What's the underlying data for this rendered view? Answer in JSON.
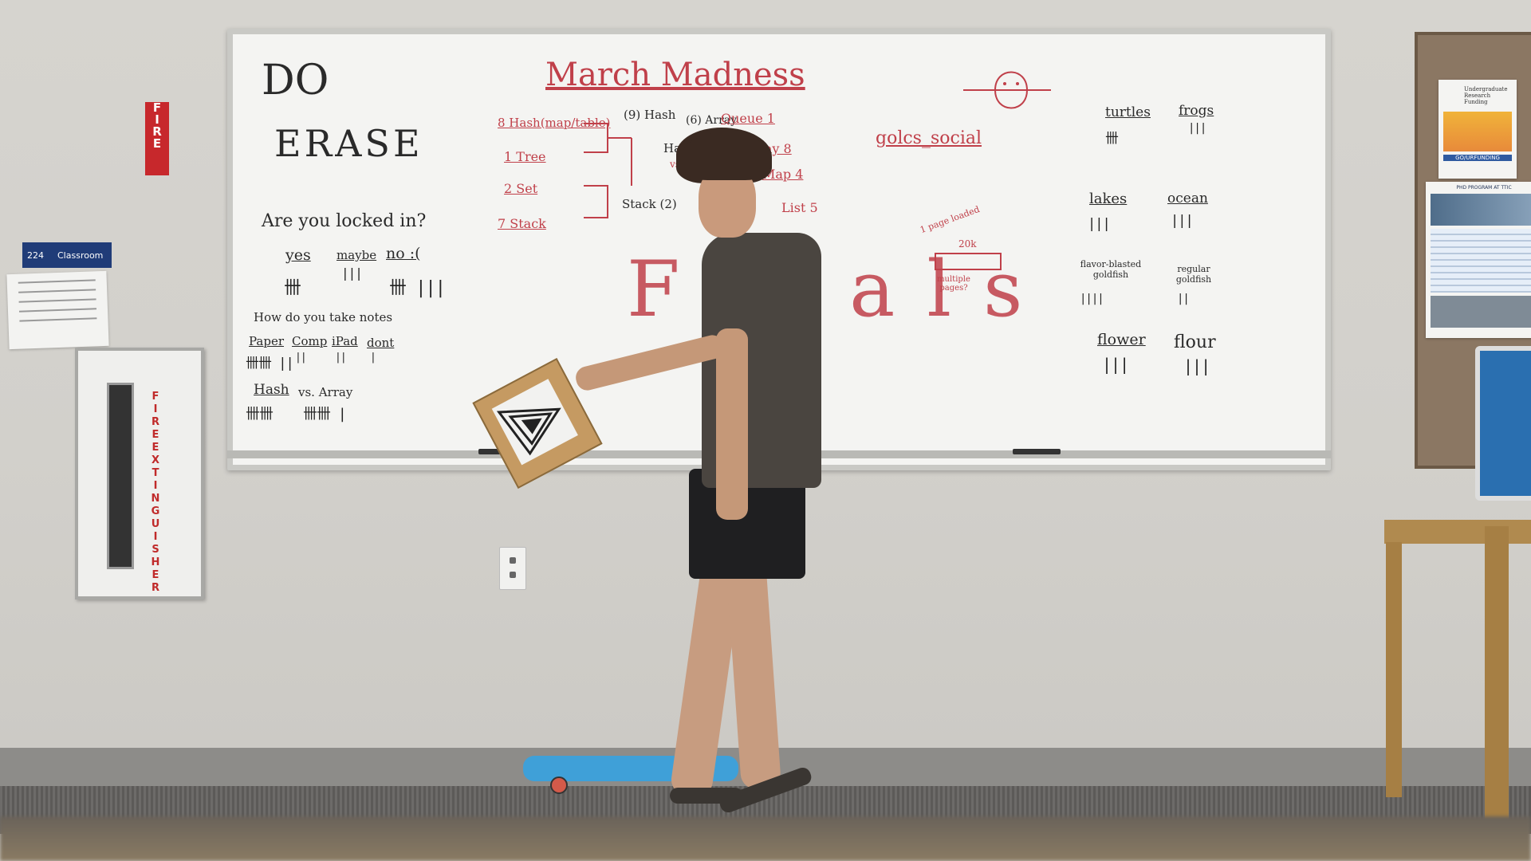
{
  "signs": {
    "fire": [
      "F",
      "I",
      "R",
      "E"
    ],
    "room_number": "224",
    "room_label": "Classroom",
    "cabinet": [
      "F",
      "I",
      "R",
      "E",
      " ",
      "E",
      "X",
      "T",
      "I",
      "N",
      "G",
      "U",
      "I",
      "S",
      "H",
      "E",
      "R"
    ]
  },
  "board": {
    "do": "DO",
    "erase": "ERASE",
    "locked_q": "Are you locked in?",
    "yes": "yes",
    "maybe": "maybe",
    "no": "no :(",
    "notes_q": "How do you take notes",
    "paper": "Paper",
    "comp": "Comp",
    "ipad": "iPad",
    "dont": "dont",
    "hash_vs": "Hash",
    "vs_array": "vs. Array",
    "march_title": "March Madness",
    "b_hash_map": "8  Hash(map/table)",
    "b_tree": "1  Tree",
    "b_set": "2  Set",
    "b_stack": "7  Stack",
    "b_hash9": "(9) Hash",
    "b_stack2": "Stack (2)",
    "b_array6": "(6) Array",
    "b_hash": "Hash",
    "b_vs": "vs",
    "b_queue": "Queue  1",
    "b_array8": "Array  8",
    "b_map4": "Map  4",
    "b_list5": "List  5",
    "finals": "Finals",
    "social": "golcs_social",
    "page_note": "1 page loaded",
    "twok": "20k",
    "multiple": "multiple pages?",
    "turtles": "turtles",
    "frogs": "frogs",
    "lakes": "lakes",
    "ocean": "ocean",
    "goldfish_fb": "flavor-blasted goldfish",
    "goldfish_reg": "regular goldfish",
    "flower": "flower",
    "flour": "flour"
  },
  "tallies": {
    "yes": "卌",
    "maybe": "|||",
    "no": "卌 |||",
    "paper": "卌卌 ||",
    "comp": "||",
    "ipad": "||",
    "dont": "|",
    "hash": "卌卌",
    "array": "卌卌 |",
    "turtles": "卌",
    "frogs": "|||",
    "lakes": "|||",
    "ocean": "|||",
    "fb": "||||",
    "reg": "||",
    "flower": "|||",
    "flour": "|||"
  },
  "bulletin": {
    "flyer1_title": "Undergraduate Research Funding",
    "flyer1_footer": "GO/URFUNDING",
    "flyer2_title": "PHD PROGRAM AT TTIC"
  },
  "colors": {
    "marker_red": "#c0404a",
    "marker_black": "#222222",
    "fire_red": "#c7282c",
    "room_sign_blue": "#203c78"
  }
}
